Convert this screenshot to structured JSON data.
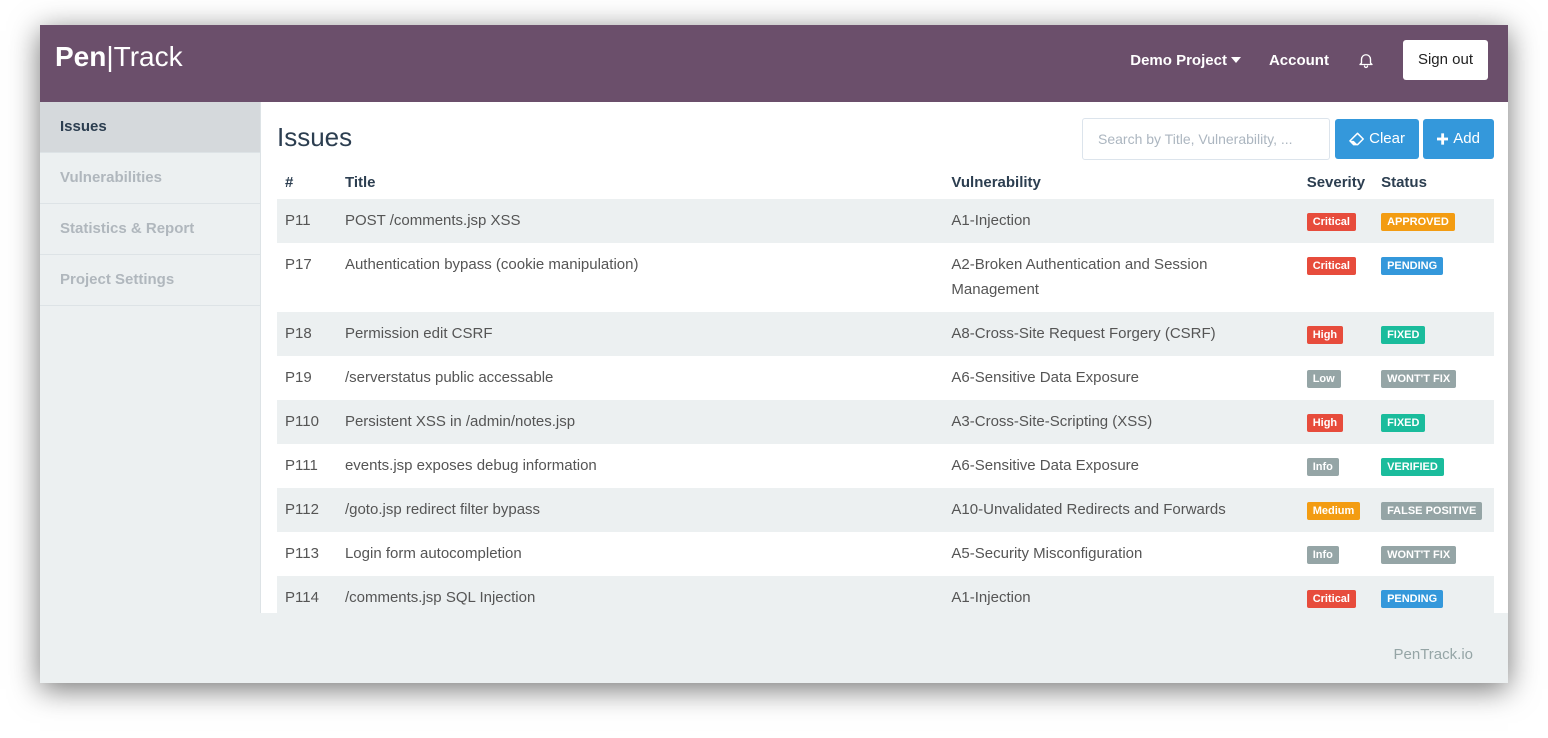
{
  "header": {
    "brand_left": "Pen",
    "brand_sep": "|",
    "brand_right": "Track",
    "project_label": "Demo Project",
    "account_label": "Account",
    "bell_icon": "bell-icon",
    "signout_label": "Sign out"
  },
  "sidebar": {
    "items": [
      {
        "label": "Issues",
        "active": true
      },
      {
        "label": "Vulnerabilities",
        "active": false
      },
      {
        "label": "Statistics & Report",
        "active": false
      },
      {
        "label": "Project Settings",
        "active": false
      }
    ]
  },
  "main": {
    "title": "Issues",
    "search_placeholder": "Search by Title, Vulnerability, ...",
    "clear_label": "Clear",
    "clear_icon": "eraser-icon",
    "add_label": "Add",
    "add_icon": "plus-icon"
  },
  "table": {
    "columns": [
      "#",
      "Title",
      "Vulnerability",
      "Severity",
      "Status"
    ],
    "rows": [
      {
        "id": "P11",
        "title": "POST /comments.jsp XSS",
        "vulnerability": "A1-Injection",
        "severity": "Critical",
        "status": "APPROVED"
      },
      {
        "id": "P17",
        "title": "Authentication bypass (cookie manipulation)",
        "vulnerability": "A2-Broken Authentication and Session Management",
        "severity": "Critical",
        "status": "PENDING"
      },
      {
        "id": "P18",
        "title": "Permission edit CSRF",
        "vulnerability": "A8-Cross-Site Request Forgery (CSRF)",
        "severity": "High",
        "status": "FIXED"
      },
      {
        "id": "P19",
        "title": "/serverstatus public accessable",
        "vulnerability": "A6-Sensitive Data Exposure",
        "severity": "Low",
        "status": "WONT'T FIX"
      },
      {
        "id": "P110",
        "title": "Persistent XSS in /admin/notes.jsp",
        "vulnerability": "A3-Cross-Site-Scripting (XSS)",
        "severity": "High",
        "status": "FIXED"
      },
      {
        "id": "P111",
        "title": "events.jsp exposes debug information",
        "vulnerability": "A6-Sensitive Data Exposure",
        "severity": "Info",
        "status": "VERIFIED"
      },
      {
        "id": "P112",
        "title": "/goto.jsp redirect filter bypass",
        "vulnerability": "A10-Unvalidated Redirects and Forwards",
        "severity": "Medium",
        "status": "FALSE POSITIVE"
      },
      {
        "id": "P113",
        "title": "Login form autocompletion",
        "vulnerability": "A5-Security Misconfiguration",
        "severity": "Info",
        "status": "WONT'T FIX"
      },
      {
        "id": "P114",
        "title": "/comments.jsp SQL Injection",
        "vulnerability": "A1-Injection",
        "severity": "Critical",
        "status": "PENDING"
      }
    ]
  },
  "colors": {
    "navbar": "#6b4f6b",
    "primary": "#3498db",
    "severity": {
      "Critical": "#e74c3c",
      "High": "#e74c3c",
      "Medium": "#f39c12",
      "Low": "#95a5a6",
      "Info": "#95a5a6"
    },
    "status": {
      "APPROVED": "#f39c12",
      "PENDING": "#3498db",
      "FIXED": "#1abc9c",
      "VERIFIED": "#1abc9c",
      "WONT'T FIX": "#95a5a6",
      "FALSE POSITIVE": "#95a5a6"
    }
  },
  "footer": {
    "text": "PenTrack.io"
  }
}
